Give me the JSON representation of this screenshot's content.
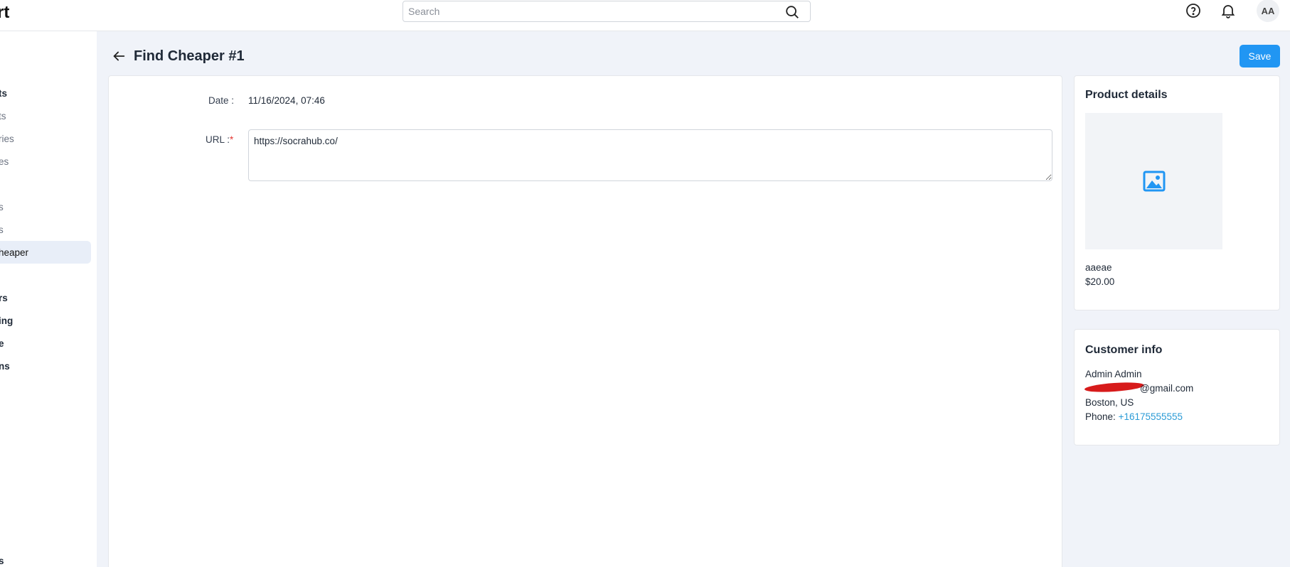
{
  "app": {
    "brand_fragment": "rt"
  },
  "search": {
    "placeholder": "Search"
  },
  "header_icons": [
    "help-icon",
    "bell-icon"
  ],
  "user": {
    "initials": "AA"
  },
  "sidebar": {
    "items": [
      {
        "label": "ts",
        "kind": "group"
      },
      {
        "label": "ts",
        "kind": "sub"
      },
      {
        "label": "ries",
        "kind": "sub"
      },
      {
        "label": "es",
        "kind": "sub"
      },
      {
        "label": "s",
        "kind": "sub"
      },
      {
        "label": "s",
        "kind": "sub"
      },
      {
        "label": "heaper",
        "kind": "active"
      },
      {
        "label": "rs",
        "kind": "group"
      },
      {
        "label": "ing",
        "kind": "group"
      },
      {
        "label": "e",
        "kind": "group"
      },
      {
        "label": "ns",
        "kind": "group"
      },
      {
        "label": "s",
        "kind": "group"
      }
    ]
  },
  "page": {
    "title": "Find Cheaper #1",
    "save_label": "Save"
  },
  "form": {
    "date_label": "Date :",
    "date_value": "11/16/2024, 07:46",
    "url_label": "URL :",
    "url_required_mark": "*",
    "url_value": "https://socrahub.co/"
  },
  "product_details": {
    "title": "Product details",
    "image_icon": "image-icon",
    "name": "aaeae",
    "price": "$20.00"
  },
  "customer_info": {
    "title": "Customer info",
    "name": "Admin Admin",
    "email_visible": "@gmail.com",
    "location": "Boston, US",
    "phone_label": "Phone:",
    "phone_value": "+16175555555"
  },
  "colors": {
    "accent": "#2196f3",
    "link": "#2b9bd6",
    "required": "#e53935",
    "redaction": "#d71b1b",
    "background": "#f0f3f9"
  }
}
